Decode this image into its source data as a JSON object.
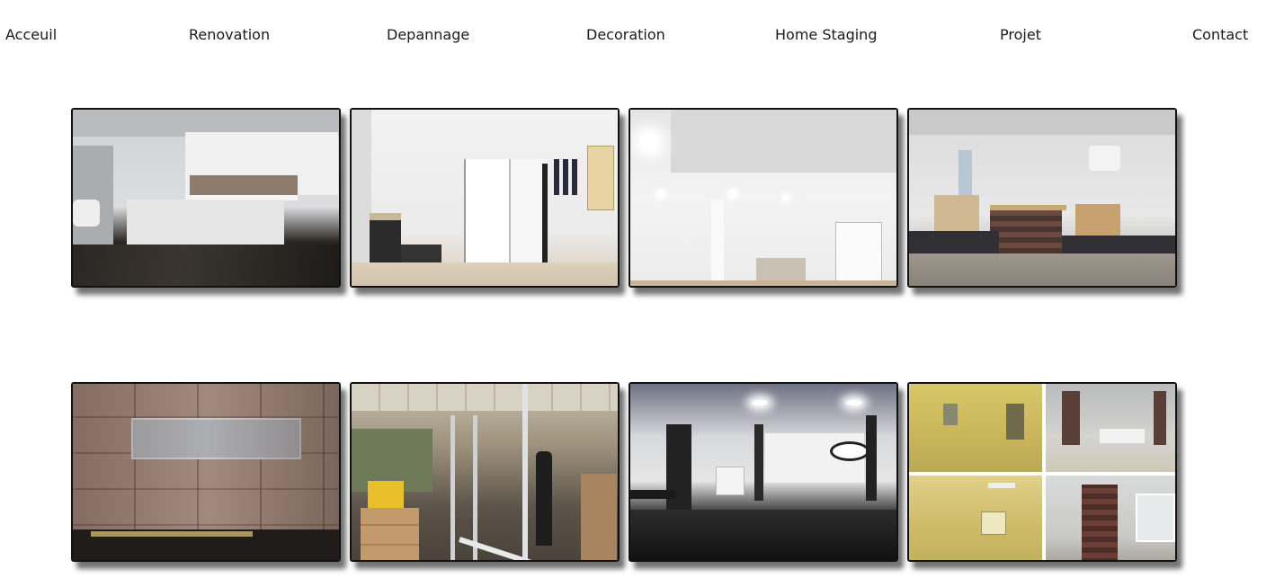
{
  "nav": {
    "items": [
      {
        "label": "Acceuil"
      },
      {
        "label": "Renovation"
      },
      {
        "label": "Depannage"
      },
      {
        "label": "Decoration"
      },
      {
        "label": "Home Staging"
      },
      {
        "label": "Projet"
      },
      {
        "label": "Contact"
      }
    ]
  },
  "gallery": {
    "photos": [
      {
        "subject": "renovated kitchen with counter and dark floor"
      },
      {
        "subject": "hallway with white doors and electrical panel"
      },
      {
        "subject": "white room with recessed ceiling lights"
      },
      {
        "subject": "studio with brick counter and kitchenette"
      },
      {
        "subject": "tiled shower wall with niche"
      },
      {
        "subject": "office under construction with metal studs"
      },
      {
        "subject": "dark floored office with wall clock"
      },
      {
        "subject": "before and after collage with yellow walls and brick"
      }
    ]
  }
}
